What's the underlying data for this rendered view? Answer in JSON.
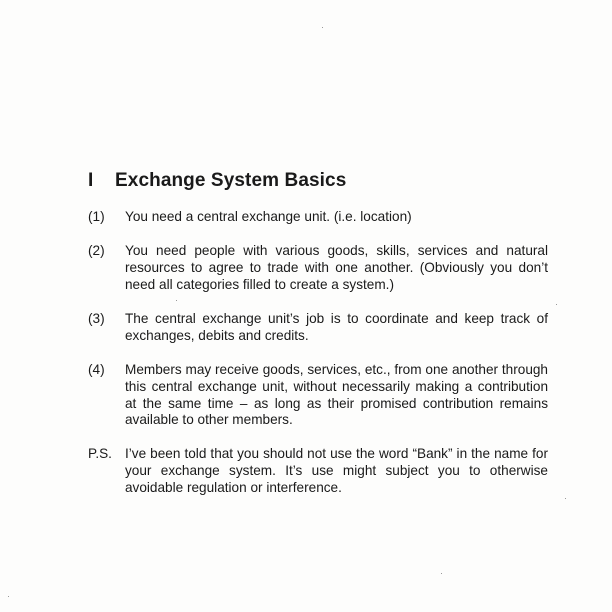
{
  "section": {
    "number": "I",
    "title": "Exchange System Basics"
  },
  "items": [
    {
      "marker": "(1)",
      "text": "You need a central exchange unit. (i.e. location)"
    },
    {
      "marker": "(2)",
      "text": "You need people with various goods, skills, services and natural resources to agree to trade with one another. (Obviously you don’t need all categories filled to create a system.)"
    },
    {
      "marker": "(3)",
      "text": "The central exchange unit’s job is to coordinate and keep track of exchanges, debits and credits."
    },
    {
      "marker": "(4)",
      "text": "Members may receive goods, services, etc., from one another through this central exchange unit, without necessarily making a contribution at the same time – as long as their promised contribution remains available to other members."
    },
    {
      "marker": "P.S.",
      "text": "I’ve been told that you should not use the word “Bank” in the name for your exchange system.  It’s use might subject you to otherwise avoidable regulation or interference."
    }
  ]
}
